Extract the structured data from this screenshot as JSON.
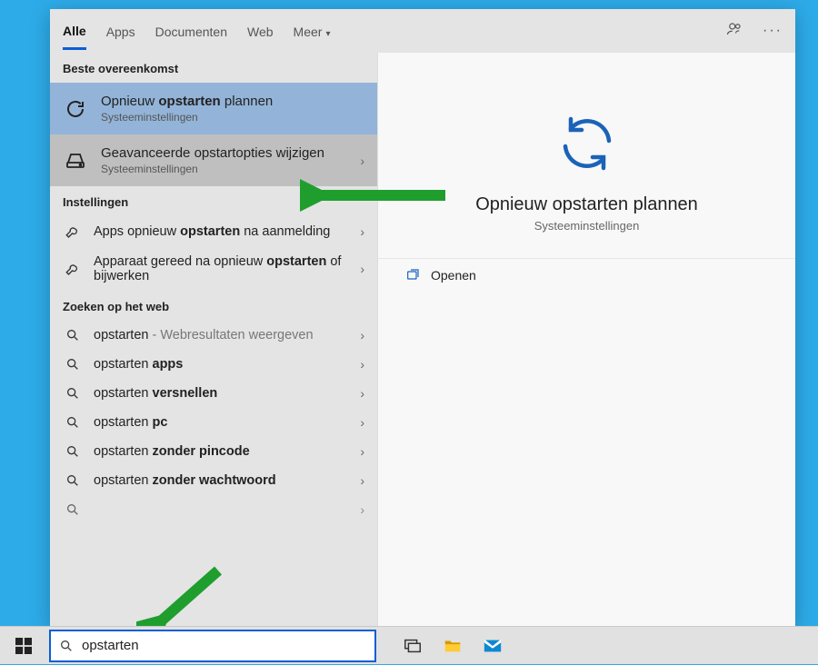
{
  "tabs": {
    "all": "Alle",
    "apps": "Apps",
    "documents": "Documenten",
    "web": "Web",
    "more": "Meer"
  },
  "sections": {
    "best_match": "Beste overeenkomst",
    "settings": "Instellingen",
    "web": "Zoeken op het web"
  },
  "best": {
    "item1_pre": "Opnieuw ",
    "item1_bold": "opstarten",
    "item1_post": " plannen",
    "item1_sub": "Systeeminstellingen",
    "item2_title": "Geavanceerde opstartopties wijzigen",
    "item2_sub": "Systeeminstellingen"
  },
  "settings_items": {
    "a_pre": "Apps opnieuw ",
    "a_bold": "opstarten",
    "a_post": " na aanmelding",
    "b_pre": "Apparaat gereed na opnieuw ",
    "b_bold": "opstarten",
    "b_post": " of bijwerken"
  },
  "web_items": {
    "w1_bold": "opstarten",
    "w1_suffix": " - Webresultaten weergeven",
    "w2_pre": "opstarten ",
    "w2_bold": "apps",
    "w3_pre": "opstarten ",
    "w3_bold": "versnellen",
    "w4_pre": "opstarten ",
    "w4_bold": "pc",
    "w5_pre": "opstarten ",
    "w5_bold": "zonder pincode",
    "w6_pre": "opstarten ",
    "w6_bold": "zonder wachtwoord"
  },
  "preview": {
    "title": "Opnieuw opstarten plannen",
    "sub": "Systeeminstellingen",
    "open": "Openen"
  },
  "search": {
    "value": "opstarten"
  },
  "chevron": "›",
  "ellipsis": "···"
}
